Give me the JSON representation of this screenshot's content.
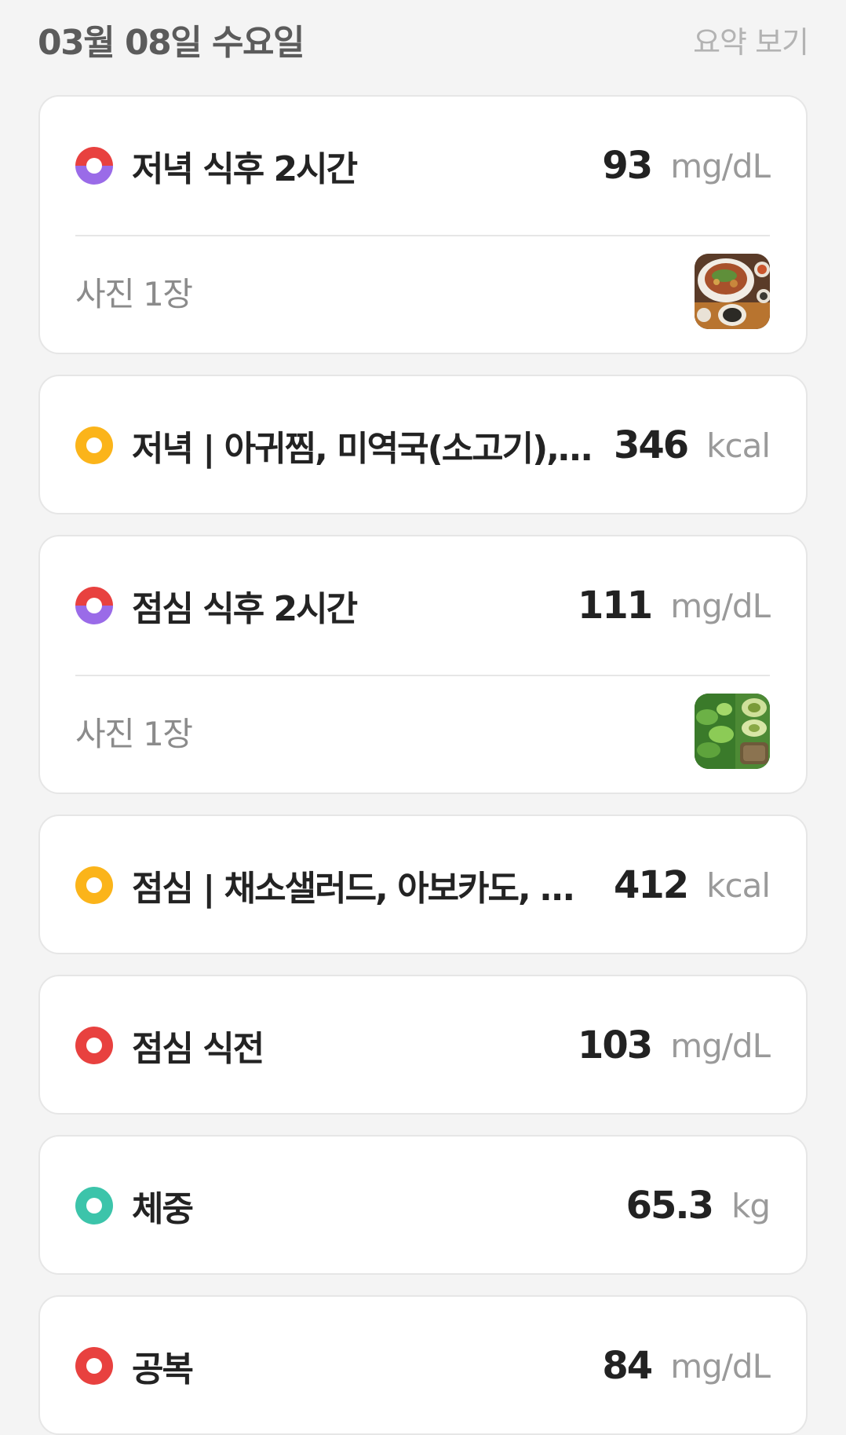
{
  "header": {
    "date": "03월 08일 수요일",
    "summary_link": "요약 보기"
  },
  "entries": [
    {
      "label": "저녁 식후 2시간",
      "value": "93",
      "unit": "mg/dL",
      "icon": "glucose-post-meal-icon",
      "photo_count": "사진 1장",
      "photo": "dinner-meal-photo"
    },
    {
      "label": "저녁 | 아귀찜, 미역국(소고기), 현미밥",
      "value": "346",
      "unit": "kcal",
      "icon": "meal-icon"
    },
    {
      "label": "점심 식후 2시간",
      "value": "111",
      "unit": "mg/dL",
      "icon": "glucose-post-meal-icon",
      "photo_count": "사진 1장",
      "photo": "lunch-meal-photo"
    },
    {
      "label": "점심 | 채소샐러드, 아보카도, 식빵",
      "value": "412",
      "unit": "kcal",
      "icon": "meal-icon"
    },
    {
      "label": "점심 식전",
      "value": "103",
      "unit": "mg/dL",
      "icon": "glucose-icon"
    },
    {
      "label": "체중",
      "value": "65.3",
      "unit": "kg",
      "icon": "weight-icon"
    },
    {
      "label": "공복",
      "value": "84",
      "unit": "mg/dL",
      "icon": "glucose-icon"
    }
  ],
  "colors": {
    "glucose_red": "#e8413f",
    "post_meal_purple": "#9a6be8",
    "meal_yellow": "#fbb41a",
    "weight_teal": "#3cc4aa"
  }
}
